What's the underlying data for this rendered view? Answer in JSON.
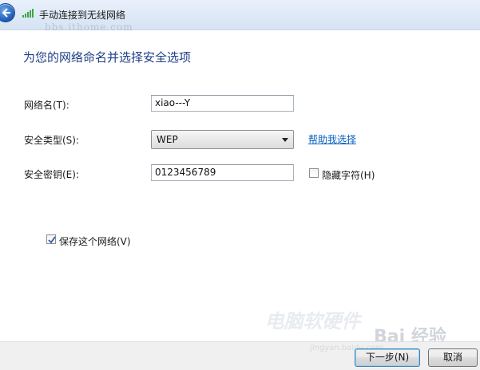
{
  "window": {
    "title": "手动连接到无线网络",
    "watermark_title": "bbs.ithome.com"
  },
  "heading": "为您的网络命名并选择安全选项",
  "form": {
    "network_name": {
      "label": "网络名(T):",
      "value": "xiao---Y"
    },
    "security_type": {
      "label": "安全类型(S):",
      "value": "WEP",
      "help_link": "帮助我选择"
    },
    "security_key": {
      "label": "安全密钥(E):",
      "value": "0123456789",
      "hide_chars_label": "隐藏字符(H)",
      "hide_chars_checked": false
    },
    "save_network": {
      "label": "保存这个网络(V)",
      "checked": true
    }
  },
  "watermarks": {
    "logo_text": "电脑软硬件",
    "baidu": "Bai 经验",
    "baidu_sub": "jingyan.baidu.com"
  },
  "buttons": {
    "next": "下一步(N)",
    "cancel": "取消"
  },
  "icons": {
    "back": "back-arrow-icon",
    "signal": "wireless-signal-icon"
  },
  "colors": {
    "heading": "#1e3f86",
    "link": "#0a5fc3"
  }
}
